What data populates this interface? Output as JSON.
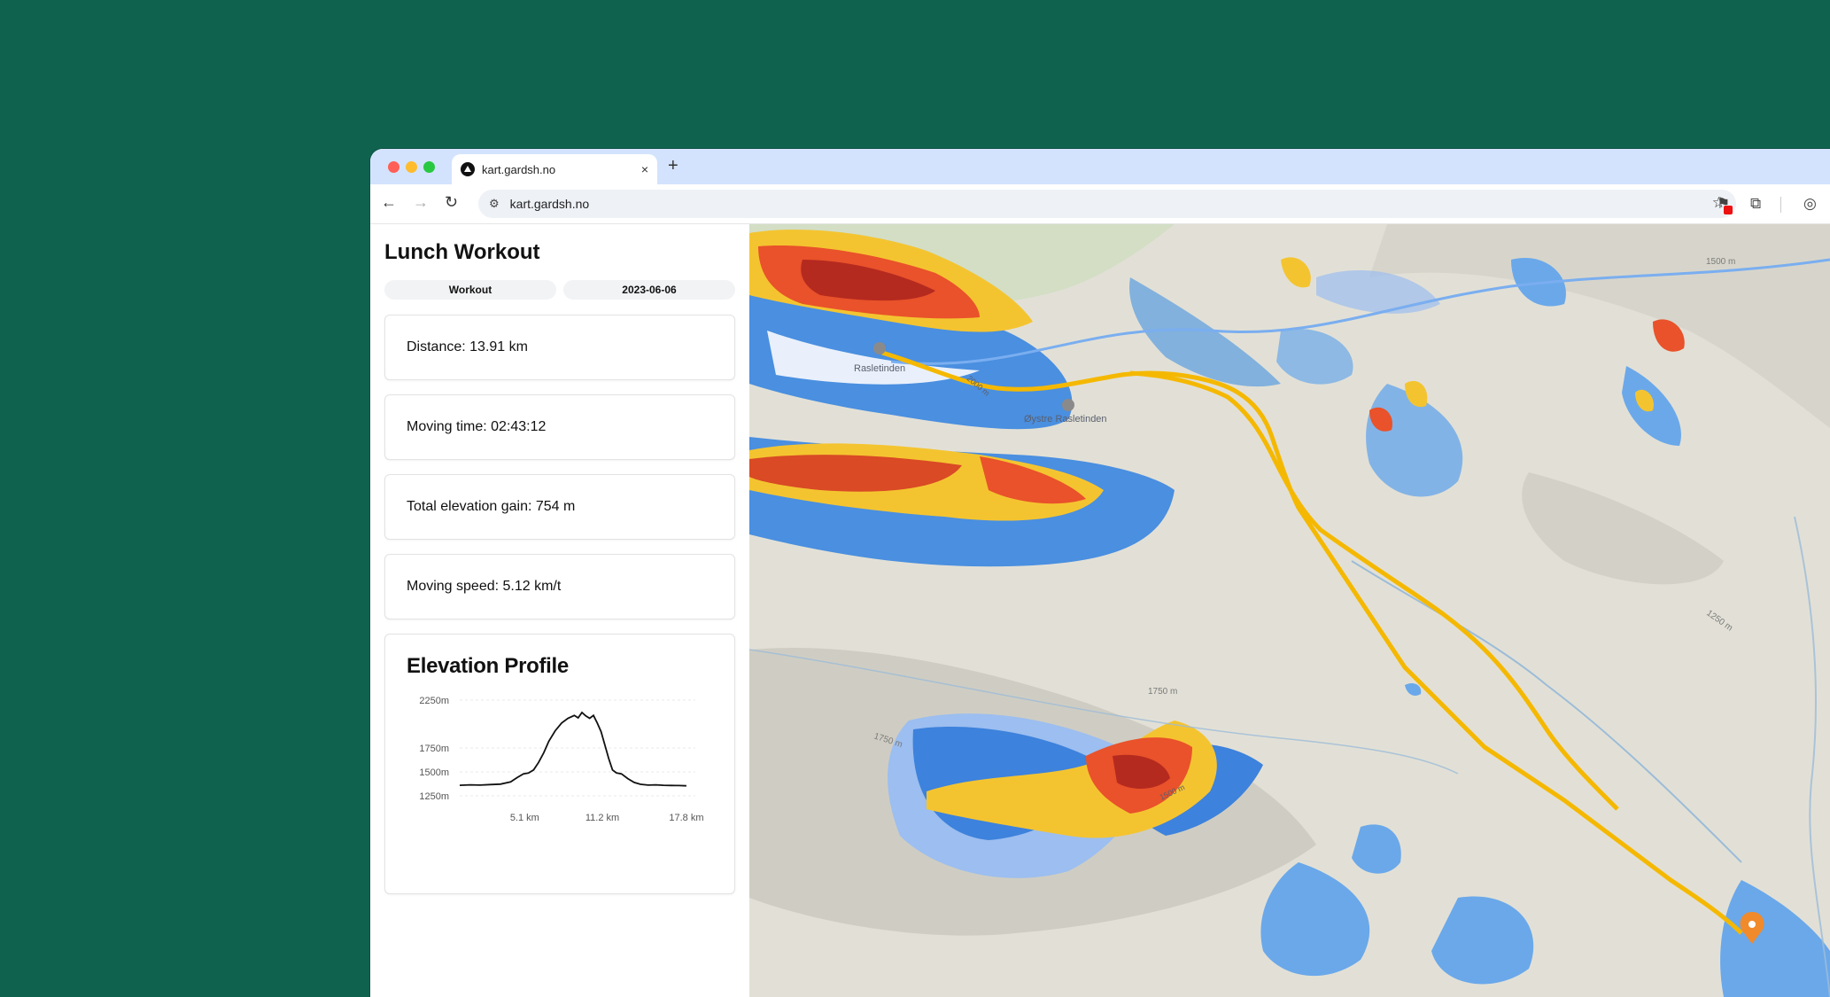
{
  "browser": {
    "tab_title": "kart.gardsh.no",
    "tab_close": "×",
    "new_tab": "+",
    "url": "kart.gardsh.no"
  },
  "sidebar": {
    "title": "Lunch Workout",
    "type_badge": "Workout",
    "date_badge": "2023-06-06",
    "stats": {
      "distance": "Distance: 13.91 km",
      "moving_time": "Moving time: 02:43:12",
      "elevation_gain": "Total elevation gain: 754 m",
      "moving_speed": "Moving speed: 5.12 km/t"
    },
    "profile_title": "Elevation Profile"
  },
  "map": {
    "peak1_label": "Rasletinden",
    "peak2_label": "Øystre Rasletinden",
    "contour_labels": {
      "c1750a": "1750 m",
      "c1750b": "1750 m",
      "c1500": "1500 m",
      "c1250": "1250 m",
      "c2000": "2000 m",
      "c1500b": "1500 m"
    },
    "colors": {
      "route": "#f5b800",
      "marker": "#f08a2b",
      "water": "#5a9de0"
    }
  },
  "chart_data": {
    "type": "line",
    "title": "Elevation Profile",
    "xlabel": "",
    "ylabel": "",
    "y_ticks": [
      "2250m",
      "1750m",
      "1500m",
      "1250m"
    ],
    "x_ticks": [
      "5.1 km",
      "11.2 km",
      "17.8 km"
    ],
    "x_tick_values": [
      5.1,
      11.2,
      17.8
    ],
    "xlim": [
      0,
      18.5
    ],
    "ylim": [
      1250,
      2250
    ],
    "x": [
      0,
      0.8,
      1.6,
      2.4,
      3.2,
      4.0,
      4.5,
      5.0,
      5.4,
      5.8,
      6.2,
      6.6,
      7.0,
      7.5,
      8.0,
      8.5,
      9.0,
      9.3,
      9.6,
      9.9,
      10.2,
      10.5,
      10.8,
      11.1,
      11.4,
      11.7,
      12.0,
      12.3,
      12.7,
      13.2,
      13.7,
      14.2,
      14.8,
      15.4,
      16.0,
      16.6,
      17.2,
      17.8
    ],
    "y": [
      1360,
      1365,
      1362,
      1368,
      1372,
      1395,
      1440,
      1480,
      1488,
      1520,
      1600,
      1700,
      1820,
      1930,
      2010,
      2060,
      2090,
      2065,
      2120,
      2085,
      2060,
      2090,
      2010,
      1920,
      1780,
      1640,
      1520,
      1490,
      1480,
      1430,
      1390,
      1370,
      1362,
      1365,
      1360,
      1358,
      1357,
      1355
    ],
    "grid": true
  }
}
